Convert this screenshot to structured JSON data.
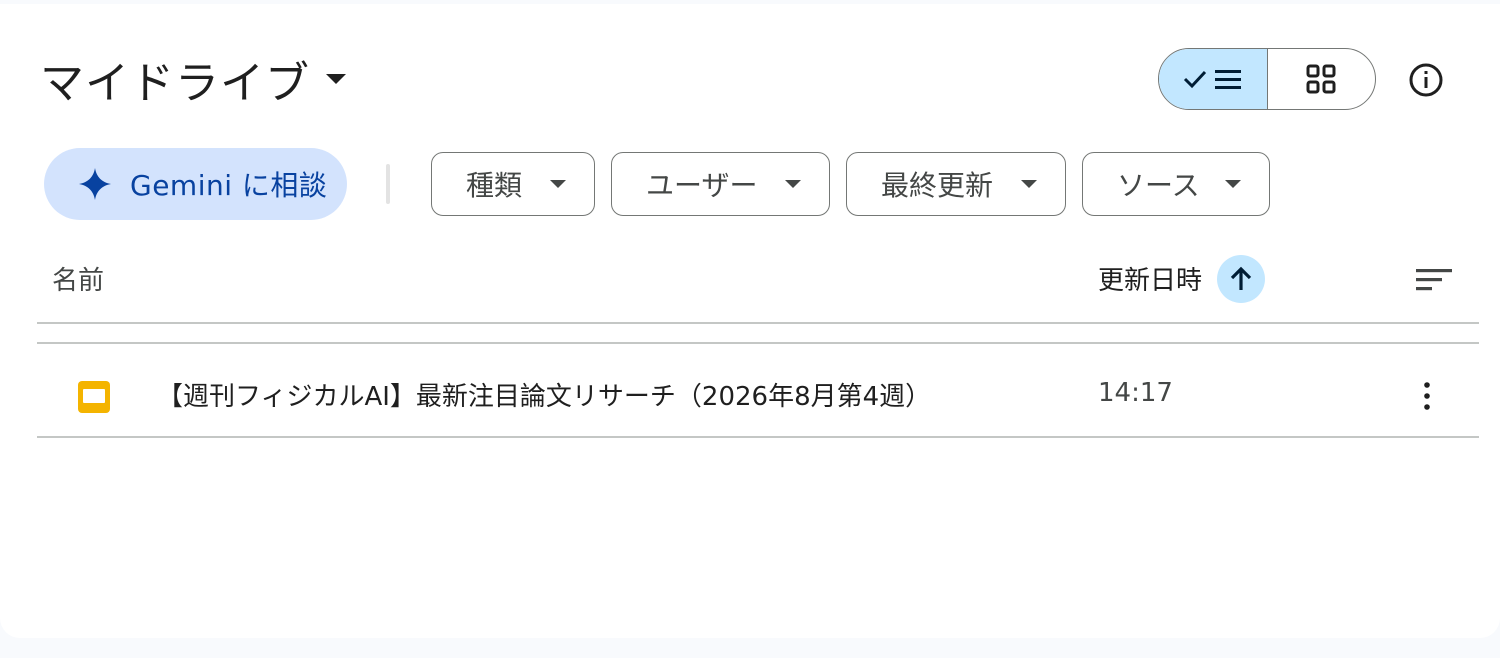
{
  "header": {
    "title": "マイドライブ",
    "view_toggle": {
      "list_icon": "check-list-icon",
      "grid_icon": "grid-icon",
      "active": "list"
    },
    "info_icon": "info-icon"
  },
  "toolbar": {
    "gemini_label": "Gemini に相談",
    "gemini_icon": "gemini-sparkle-icon",
    "filters": [
      {
        "label": "種類"
      },
      {
        "label": "ユーザー"
      },
      {
        "label": "最終更新"
      },
      {
        "label": "ソース"
      }
    ]
  },
  "table": {
    "columns": {
      "name": "名前",
      "modified": "更新日時"
    },
    "sort_direction": "ascending",
    "rows": [
      {
        "icon": "slides-file-icon",
        "name": "【週刊フィジカルAI】最新注目論文リサーチ（2026年8月第4週）",
        "modified": "14:17"
      }
    ]
  },
  "colors": {
    "accent": "#c2e7ff",
    "gemini_bg": "#d3e3fd",
    "gemini_text": "#0842a0",
    "slides_icon": "#f4b400"
  }
}
